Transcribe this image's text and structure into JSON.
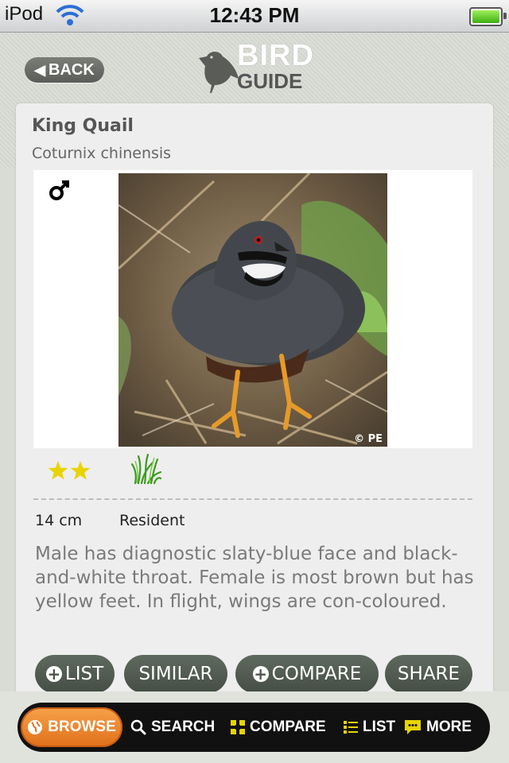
{
  "status_bar": {
    "carrier": "iPod",
    "time": "12:43 PM"
  },
  "header": {
    "back_label": "BACK",
    "logo": {
      "line1": "BIRD",
      "line2": "GUIDE"
    }
  },
  "species": {
    "common_name": "King Quail",
    "scientific_name": "Coturnix chinensis",
    "gender_symbol": "♂",
    "photo_credit": "© PE",
    "rarity_stars": 2,
    "size": "14 cm",
    "status": "Resident",
    "description": "Male has diagnostic slaty-blue face and black-and-white throat. Female is most brown but has yellow feet. In flight, wings are con-coloured."
  },
  "actions": {
    "list": "LIST",
    "similar": "SIMILAR",
    "compare": "COMPARE",
    "share": "SHARE"
  },
  "tabs": {
    "browse": "BROWSE",
    "search": "SEARCH",
    "compare": "COMPARE",
    "list": "LIST",
    "more": "MORE"
  },
  "colors": {
    "accent_orange": "#e0701a",
    "star_yellow": "#e8d400",
    "button_gray": "#4b544b"
  }
}
